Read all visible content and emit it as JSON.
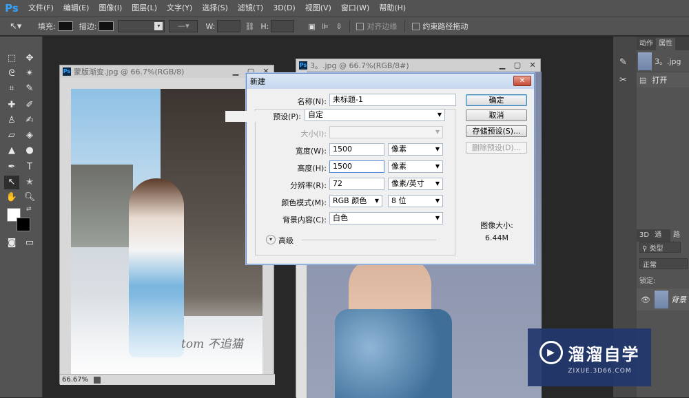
{
  "app": {
    "logo": "Ps"
  },
  "menubar": [
    "文件(F)",
    "编辑(E)",
    "图像(I)",
    "图层(L)",
    "文字(Y)",
    "选择(S)",
    "滤镜(T)",
    "3D(D)",
    "视图(V)",
    "窗口(W)",
    "帮助(H)"
  ],
  "options": {
    "fill_label": "填充:",
    "stroke_label": "描边:",
    "w_label": "W:",
    "h_label": "H:",
    "align_edges": "对齐边缘",
    "constrain_path": "约束路径拖动"
  },
  "doc1": {
    "title": "蒙版渐变.jpg @ 66.7%(RGB/8)",
    "zoom": "66.67%",
    "signature": "tom 不追猫"
  },
  "doc2": {
    "title": "3。.jpg @ 66.7%(RGB/8#)"
  },
  "dialog": {
    "title": "新建",
    "name_label": "名称(N):",
    "name_value": "未标题-1",
    "preset_label": "预设(P):",
    "preset_value": "自定",
    "size_label": "大小(I):",
    "width_label": "宽度(W):",
    "width_value": "1500",
    "width_unit": "像素",
    "height_label": "高度(H):",
    "height_value": "1500",
    "height_unit": "像素",
    "res_label": "分辨率(R):",
    "res_value": "72",
    "res_unit": "像素/英寸",
    "mode_label": "颜色模式(M):",
    "mode_value": "RGB 颜色",
    "bits_value": "8 位",
    "bg_label": "背景内容(C):",
    "bg_value": "白色",
    "advanced_label": "高级",
    "ok": "确定",
    "cancel": "取消",
    "save_preset": "存储预设(S)...",
    "delete_preset": "删除预设(D)...",
    "image_size_label": "图像大小:",
    "image_size_value": "6.44M"
  },
  "right_panel": {
    "tab_actions": "动作",
    "tab_properties": "属性",
    "history_item": "3。.jpg",
    "open_label": "打开",
    "tab_3d": "3D",
    "tab_channels": "通道",
    "tab_paths": "路径",
    "kind_label": "类型",
    "blend_mode": "正常",
    "lock_label": "锁定:",
    "layer_name": "背景"
  },
  "watermark": {
    "cn": "溜溜自学",
    "url": "ZIXUE.3D66.COM"
  },
  "colors": {
    "ps_blue": "#33a3ff",
    "ui_dark": "#535353",
    "dialog_bg": "#f0f0f0"
  }
}
